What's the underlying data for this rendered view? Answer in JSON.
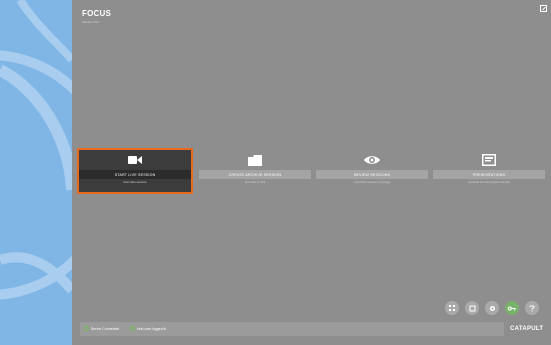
{
  "app": {
    "title": "FOCUS",
    "version": "Version 2.5.1"
  },
  "cards": [
    {
      "label": "START LIVE SESSION",
      "subtitle": "Start video sessions",
      "icon": "video-camera-icon"
    },
    {
      "label": "CREATE ARCHIVE SESSION",
      "subtitle": "From files on disk",
      "icon": "folder-icon"
    },
    {
      "label": "REVIEW SESSIONS",
      "subtitle": "Load Focus session to package",
      "icon": "eye-icon"
    },
    {
      "label": "PRESENTATIONS",
      "subtitle": "Generate and view playlist materials",
      "icon": "presentation-icon"
    }
  ],
  "status": {
    "server": "Server Connected",
    "hub": "Hub user logged in"
  },
  "brand": {
    "logo": "CATAPULT"
  },
  "bottom_icons": [
    "grid-icon",
    "crop-icon",
    "gear-icon",
    "key-icon",
    "help-icon"
  ],
  "colors": {
    "accent": "#e86a1e",
    "sidebar": "#7fb6e6",
    "status_ok": "#6fbf4f"
  }
}
